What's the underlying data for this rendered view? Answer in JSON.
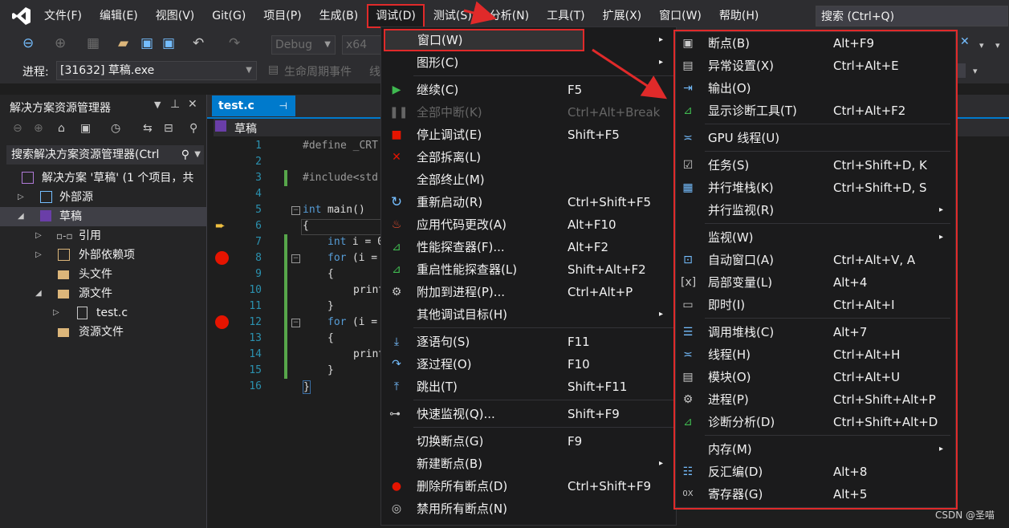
{
  "menubar": {
    "items": [
      "文件(F)",
      "编辑(E)",
      "视图(V)",
      "Git(G)",
      "项目(P)",
      "生成(B)",
      "调试(D)",
      "测试(S)",
      "分析(N)",
      "工具(T)",
      "扩展(X)",
      "窗口(W)",
      "帮助(H)"
    ],
    "search": "搜索 (Ctrl+Q)"
  },
  "toolbar": {
    "config": "Debug",
    "platform": "x64",
    "process_label": "进程:",
    "process": "[31632] 草稿.exe",
    "lifecycle": "生命周期事件",
    "trail": "线"
  },
  "solution_explorer": {
    "title": "解决方案资源管理器",
    "search": "搜索解决方案资源管理器(Ctrl",
    "tree": [
      {
        "label": "解决方案 '草稿' (1 个项目，共"
      },
      {
        "label": "外部源"
      },
      {
        "label": "草稿"
      },
      {
        "label": "引用"
      },
      {
        "label": "外部依赖项"
      },
      {
        "label": "头文件"
      },
      {
        "label": "源文件"
      },
      {
        "label": "test.c"
      },
      {
        "label": "资源文件"
      }
    ]
  },
  "editor": {
    "tab": "test.c",
    "nav": "草稿",
    "lines": [
      "1",
      "2",
      "3",
      "4",
      "5",
      "6",
      "7",
      "8",
      "9",
      "10",
      "11",
      "12",
      "13",
      "14",
      "15",
      "16"
    ],
    "code": {
      "l1": "#define _CRT",
      "l3": "#include<std",
      "l5a": "int",
      "l5b": " main()",
      "l6": "{",
      "l7a": "int",
      "l7b": " i = 0",
      "l8a": "for",
      "l8b": " (i =",
      "l9": "{",
      "l10": "print",
      "l11": "}",
      "l12a": "for",
      "l12b": " (i =",
      "l13": "{",
      "l14": "print",
      "l15": "}",
      "l16": "}"
    }
  },
  "debug_menu": {
    "items": [
      {
        "label": "窗口(W)",
        "shortcut": "",
        "arrow": "▸"
      },
      {
        "label": "图形(C)",
        "shortcut": "",
        "arrow": "▸"
      },
      {
        "label": "继续(C)",
        "shortcut": "F5"
      },
      {
        "label": "全部中断(K)",
        "shortcut": "Ctrl+Alt+Break"
      },
      {
        "label": "停止调试(E)",
        "shortcut": "Shift+F5"
      },
      {
        "label": "全部拆离(L)",
        "shortcut": ""
      },
      {
        "label": "全部终止(M)",
        "shortcut": ""
      },
      {
        "label": "重新启动(R)",
        "shortcut": "Ctrl+Shift+F5"
      },
      {
        "label": "应用代码更改(A)",
        "shortcut": "Alt+F10"
      },
      {
        "label": "性能探查器(F)...",
        "shortcut": "Alt+F2"
      },
      {
        "label": "重启性能探查器(L)",
        "shortcut": "Shift+Alt+F2"
      },
      {
        "label": "附加到进程(P)...",
        "shortcut": "Ctrl+Alt+P"
      },
      {
        "label": "其他调试目标(H)",
        "shortcut": "",
        "arrow": "▸"
      },
      {
        "label": "逐语句(S)",
        "shortcut": "F11"
      },
      {
        "label": "逐过程(O)",
        "shortcut": "F10"
      },
      {
        "label": "跳出(T)",
        "shortcut": "Shift+F11"
      },
      {
        "label": "快速监视(Q)...",
        "shortcut": "Shift+F9"
      },
      {
        "label": "切换断点(G)",
        "shortcut": "F9"
      },
      {
        "label": "新建断点(B)",
        "shortcut": "",
        "arrow": "▸"
      },
      {
        "label": "删除所有断点(D)",
        "shortcut": "Ctrl+Shift+F9"
      },
      {
        "label": "禁用所有断点(N)",
        "shortcut": ""
      }
    ]
  },
  "window_submenu": {
    "items": [
      {
        "label": "断点(B)",
        "shortcut": "Alt+F9"
      },
      {
        "label": "异常设置(X)",
        "shortcut": "Ctrl+Alt+E"
      },
      {
        "label": "输出(O)",
        "shortcut": ""
      },
      {
        "label": "显示诊断工具(T)",
        "shortcut": "Ctrl+Alt+F2"
      },
      {
        "label": "GPU 线程(U)",
        "shortcut": ""
      },
      {
        "label": "任务(S)",
        "shortcut": "Ctrl+Shift+D, K"
      },
      {
        "label": "并行堆栈(K)",
        "shortcut": "Ctrl+Shift+D, S"
      },
      {
        "label": "并行监视(R)",
        "shortcut": "",
        "arrow": "▸"
      },
      {
        "label": "监视(W)",
        "shortcut": "",
        "arrow": "▸"
      },
      {
        "label": "自动窗口(A)",
        "shortcut": "Ctrl+Alt+V, A"
      },
      {
        "label": "局部变量(L)",
        "shortcut": "Alt+4"
      },
      {
        "label": "即时(I)",
        "shortcut": "Ctrl+Alt+I"
      },
      {
        "label": "调用堆栈(C)",
        "shortcut": "Alt+7"
      },
      {
        "label": "线程(H)",
        "shortcut": "Ctrl+Alt+H"
      },
      {
        "label": "模块(O)",
        "shortcut": "Ctrl+Alt+U"
      },
      {
        "label": "进程(P)",
        "shortcut": "Ctrl+Shift+Alt+P"
      },
      {
        "label": "诊断分析(D)",
        "shortcut": "Ctrl+Shift+Alt+D"
      },
      {
        "label": "内存(M)",
        "shortcut": "",
        "arrow": "▸"
      },
      {
        "label": "反汇编(D)",
        "shortcut": "Alt+8"
      },
      {
        "label": "寄存器(G)",
        "shortcut": "Alt+5"
      }
    ]
  },
  "watermark": "CSDN @圣喵",
  "colors": {
    "accent": "#007acc",
    "highlight_box": "#e02a2a",
    "menu_bg": "#1b1b1c"
  }
}
